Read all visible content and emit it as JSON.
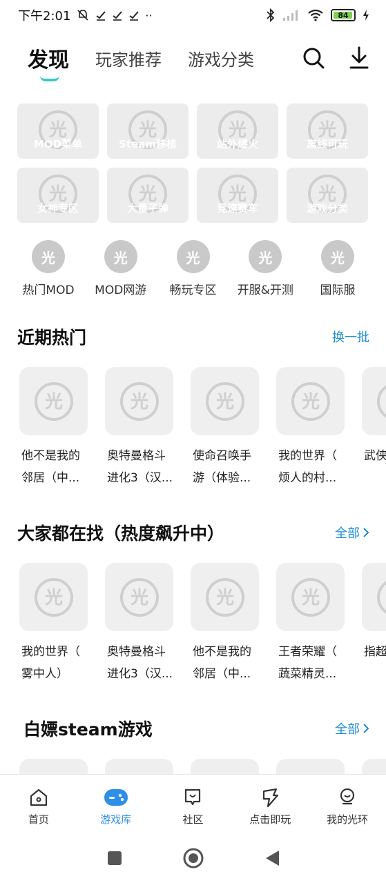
{
  "status_bar": {
    "time": "下午2:01",
    "battery": "84"
  },
  "header": {
    "tabs": [
      {
        "label": "发现"
      },
      {
        "label": "玩家推荐"
      },
      {
        "label": "游戏分类"
      }
    ]
  },
  "tiles": [
    {
      "label": "MOD菜单"
    },
    {
      "label": "Steam移植"
    },
    {
      "label": "站外爆火"
    },
    {
      "label": "离线可玩"
    },
    {
      "label": "女神专区"
    },
    {
      "label": "大量子弹"
    },
    {
      "label": "竞速赛车"
    },
    {
      "label": "游戏分类"
    }
  ],
  "shortcuts": [
    {
      "label": "热门MOD"
    },
    {
      "label": "MOD网游"
    },
    {
      "label": "畅玩专区"
    },
    {
      "label": "开服&开测"
    },
    {
      "label": "国际服"
    }
  ],
  "recent": {
    "title": "近期热门",
    "action": "换一批",
    "games": [
      {
        "line1": "他不是我的",
        "line2": "邻居（中..."
      },
      {
        "line1": "奥特曼格斗",
        "line2": "进化3（汉..."
      },
      {
        "line1": "使命召唤手",
        "line2": "游（体验..."
      },
      {
        "line1": "我的世界（",
        "line2": "烦人的村..."
      },
      {
        "line1": "武侠",
        "line2": ""
      }
    ]
  },
  "trending": {
    "title": "大家都在找（热度飙升中）",
    "action": "全部",
    "games": [
      {
        "line1": "我的世界（",
        "line2": "雾中人）"
      },
      {
        "line1": "奥特曼格斗",
        "line2": "进化3（汉..."
      },
      {
        "line1": "他不是我的",
        "line2": "邻居（中..."
      },
      {
        "line1": "王者荣耀（",
        "line2": "蔬菜精灵..."
      },
      {
        "line1": "指超",
        "line2": ""
      }
    ]
  },
  "steam": {
    "title": "白嫖steam游戏",
    "action": "全部"
  },
  "bottom_nav": [
    {
      "label": "首页"
    },
    {
      "label": "游戏库"
    },
    {
      "label": "社区"
    },
    {
      "label": "点击即玩"
    },
    {
      "label": "我的光环"
    }
  ],
  "colors": {
    "accent": "#1a8dd8",
    "tab_underline": "#3cc8c7",
    "nav_active": "#2e8fe6"
  }
}
